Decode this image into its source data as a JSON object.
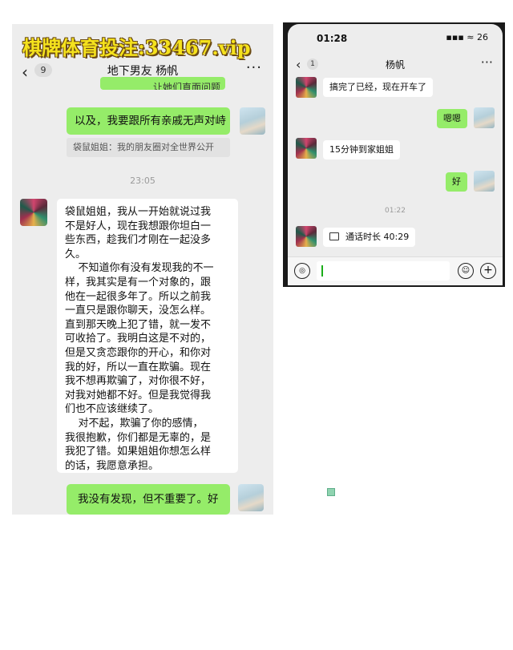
{
  "watermark": "棋牌体育投注:33467.vip",
  "left": {
    "back_glyph": "‹",
    "badge": "9",
    "title": "地下男友 杨帆",
    "more": "···",
    "cut_bubble": "让她们直面问题",
    "messages": [
      {
        "from": "me",
        "text": "以及，我要跟所有亲戚无声对峙"
      },
      {
        "from": "quote",
        "text": "袋鼠姐姐：我的朋友圈对全世界公开"
      },
      {
        "time": "23:05"
      },
      {
        "from": "her",
        "text": "袋鼠姐姐，我从一开始就说过我\n不是好人，现在我想跟你坦白一\n些东西，趁我们才刚在一起没多\n久。\n    不知道你有没有发现我的不一\n样，我其实是有一个对象的，跟\n他在一起很多年了。所以之前我\n一直只是跟你聊天，没怎么样。\n直到那天晚上犯了错，就一发不\n可收拾了。我明白这是不对的，\n但是又贪恋跟你的开心，和你对\n我的好，所以一直在欺骗。现在\n我不想再欺骗了，对你很不好，\n对我对她都不好。但是我觉得我\n们也不应该继续了。\n    对不起，欺骗了你的感情，\n我很抱歉，你们都是无辜的，是\n我犯了错。如果姐姐你想怎么样\n的话，我愿意承担。"
      },
      {
        "from": "me",
        "text": "我没有发现，但不重要了。好"
      }
    ]
  },
  "right": {
    "status_time": "01:28",
    "status_icons": "▪▪▪ ≈ 26",
    "back_glyph": "‹",
    "badge": "1",
    "title": "杨帆",
    "more": "···",
    "messages": [
      {
        "from": "her",
        "text": "搞完了已经，现在开车了"
      },
      {
        "from": "me",
        "text": "嗯嗯"
      },
      {
        "from": "her",
        "text": "15分钟到家姐姐"
      },
      {
        "from": "me",
        "text": "好"
      },
      {
        "time": "01:22"
      },
      {
        "from": "her",
        "text": "通话时长 40:29"
      }
    ],
    "voice_icon": "◎",
    "emoji_icon": "☺",
    "plus_icon": "+"
  }
}
